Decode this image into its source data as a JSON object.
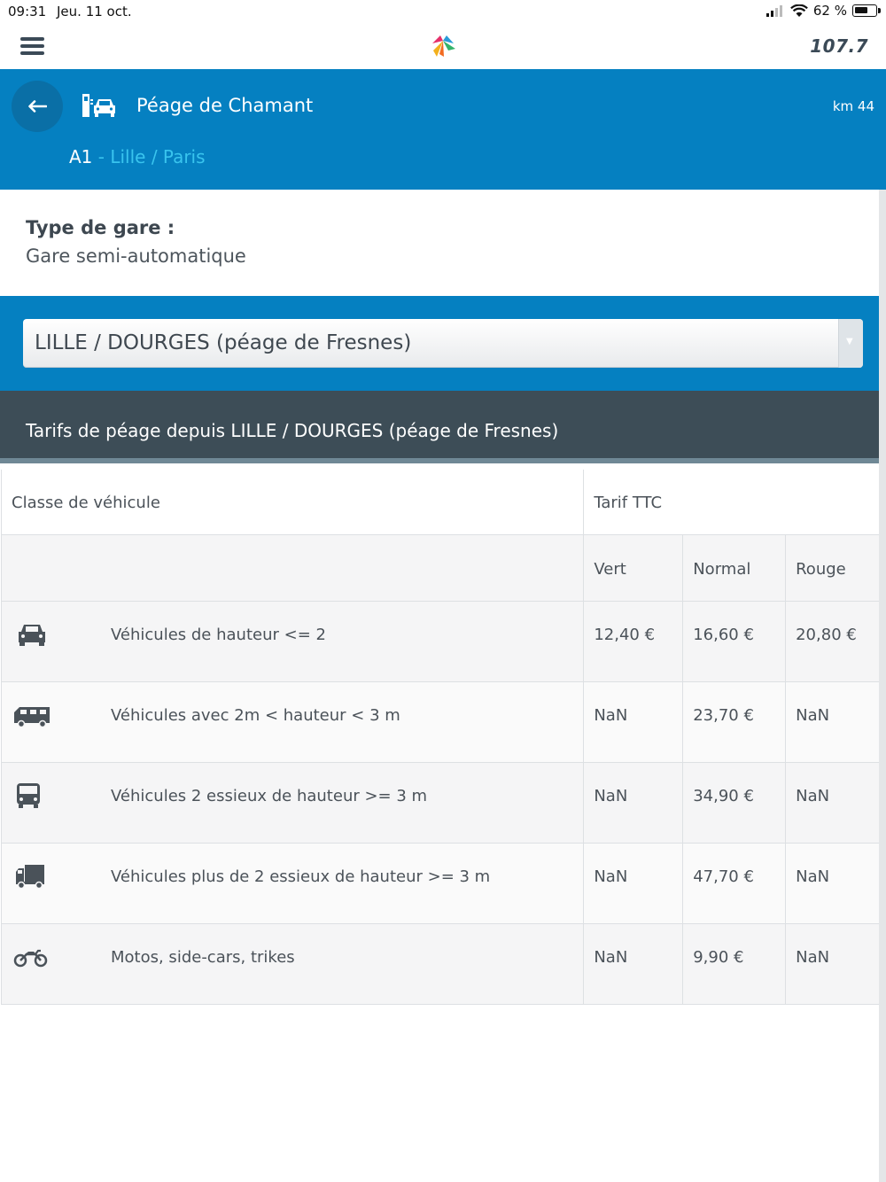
{
  "status_bar": {
    "time": "09:31",
    "date": "Jeu. 11 oct.",
    "battery": "62 %"
  },
  "header": {
    "radio": "107.7"
  },
  "station": {
    "name": "Péage de Chamant",
    "km": "km 44",
    "route_code": "A1",
    "route_name": " - Lille / Paris"
  },
  "station_type": {
    "label": "Type de gare :",
    "value": "Gare semi-automatique"
  },
  "origin_select": {
    "selected": "LILLE / DOURGES (péage de Fresnes)"
  },
  "tarifs": {
    "title": "Tarifs de péage depuis LILLE / DOURGES (péage de Fresnes)",
    "columns": {
      "class": "Classe de véhicule",
      "tarif": "Tarif TTC",
      "vert": "Vert",
      "normal": "Normal",
      "rouge": "Rouge"
    },
    "rows": [
      {
        "icon": "car-icon",
        "label": "Véhicules de hauteur <= 2",
        "vert": "12,40 €",
        "normal": "16,60 €",
        "rouge": "20,80 €"
      },
      {
        "icon": "camper-van-icon",
        "label": "Véhicules avec 2m < hauteur < 3 m",
        "vert": "NaN",
        "normal": "23,70 €",
        "rouge": "NaN"
      },
      {
        "icon": "bus-icon",
        "label": "Véhicules 2 essieux de hauteur >= 3 m",
        "vert": "NaN",
        "normal": "34,90 €",
        "rouge": "NaN"
      },
      {
        "icon": "truck-icon",
        "label": "Véhicules plus de 2 essieux de hauteur >= 3 m",
        "vert": "NaN",
        "normal": "47,70 €",
        "rouge": "NaN"
      },
      {
        "icon": "motorcycle-icon",
        "label": "Motos, side-cars, trikes",
        "vert": "NaN",
        "normal": "9,90 €",
        "rouge": "NaN"
      }
    ]
  },
  "colors": {
    "brand_blue": "#0580c1",
    "dark_band": "#3d4d57",
    "route_accent": "#39c4ee"
  }
}
